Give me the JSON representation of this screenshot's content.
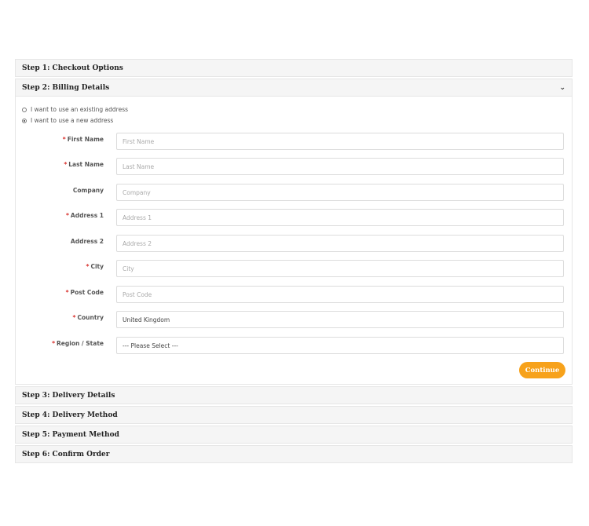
{
  "steps": [
    {
      "title": "Step 1: Checkout Options"
    },
    {
      "title": "Step 2: Billing Details",
      "chevron": "chevron-down-icon"
    },
    {
      "title": "Step 3: Delivery Details"
    },
    {
      "title": "Step 4: Delivery Method"
    },
    {
      "title": "Step 5: Payment Method"
    },
    {
      "title": "Step 6: Confirm Order"
    }
  ],
  "billing": {
    "radio_existing": "I want to use an existing address",
    "radio_new": "I want to use a new address",
    "selected_radio": "new",
    "fields": [
      {
        "label": "First Name",
        "required": true,
        "placeholder": "First Name",
        "value": ""
      },
      {
        "label": "Last Name",
        "required": true,
        "placeholder": "Last Name",
        "value": ""
      },
      {
        "label": "Company",
        "required": false,
        "placeholder": "Company",
        "value": ""
      },
      {
        "label": "Address 1",
        "required": true,
        "placeholder": "Address 1",
        "value": ""
      },
      {
        "label": "Address 2",
        "required": false,
        "placeholder": "Address 2",
        "value": ""
      },
      {
        "label": "City",
        "required": true,
        "placeholder": "City",
        "value": ""
      },
      {
        "label": "Post Code",
        "required": true,
        "placeholder": "Post Code",
        "value": ""
      },
      {
        "label": "Country",
        "required": true,
        "selected": "United Kingdom"
      },
      {
        "label": "Region / State",
        "required": true,
        "selected": "--- Please Select ---"
      }
    ],
    "continue_label": "Continue"
  },
  "colors": {
    "accent": "#f7a21b",
    "required": "#d9302c",
    "panel_bg": "#f5f5f5"
  }
}
